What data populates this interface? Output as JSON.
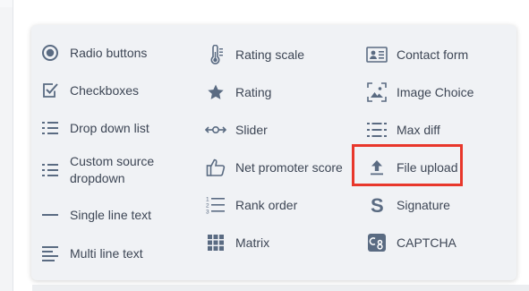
{
  "menu": {
    "column1": [
      {
        "label": "Radio buttons",
        "icon": "radio-button-icon"
      },
      {
        "label": "Checkboxes",
        "icon": "checkbox-icon"
      },
      {
        "label": "Drop down list",
        "icon": "dropdown-list-icon"
      },
      {
        "label": "Custom source dropdown",
        "icon": "custom-dropdown-icon"
      },
      {
        "label": "Single line text",
        "icon": "single-line-icon"
      },
      {
        "label": "Multi line text",
        "icon": "multi-line-icon"
      }
    ],
    "column2": [
      {
        "label": "Rating scale",
        "icon": "thermometer-icon"
      },
      {
        "label": "Rating",
        "icon": "star-icon"
      },
      {
        "label": "Slider",
        "icon": "slider-icon"
      },
      {
        "label": "Net promoter score",
        "icon": "thumbs-up-icon"
      },
      {
        "label": "Rank order",
        "icon": "rank-order-icon"
      },
      {
        "label": "Matrix",
        "icon": "matrix-icon"
      }
    ],
    "column3": [
      {
        "label": "Contact form",
        "icon": "contact-card-icon"
      },
      {
        "label": "Image Choice",
        "icon": "image-choice-icon"
      },
      {
        "label": "Max diff",
        "icon": "max-diff-icon"
      },
      {
        "label": "File upload",
        "icon": "upload-icon"
      },
      {
        "label": "Signature",
        "icon": "signature-icon"
      },
      {
        "label": "CAPTCHA",
        "icon": "captcha-icon"
      }
    ]
  },
  "colors": {
    "icon": "#5a6b82",
    "text": "#3d4655",
    "highlight": "#e8372b",
    "panel": "#f0f2f5"
  }
}
